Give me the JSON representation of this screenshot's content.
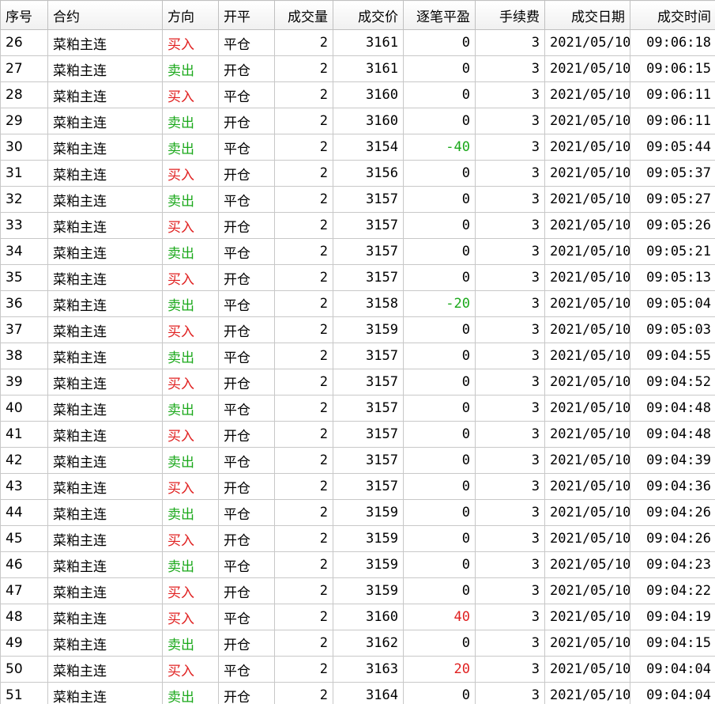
{
  "colors": {
    "buy": "#e02020",
    "sell": "#1aa81a",
    "grid_line": "#c8c8c8"
  },
  "columns": [
    "序号",
    "合约",
    "方向",
    "开平",
    "成交量",
    "成交价",
    "逐笔平盈",
    "手续费",
    "成交日期",
    "成交时间"
  ],
  "rows": [
    {
      "id": "26",
      "contract": "菜粕主连",
      "dir": "买入",
      "oc": "平仓",
      "qty": "2",
      "price": "3161",
      "pnl": "0",
      "fee": "3",
      "date": "2021/05/10",
      "time": "09:06:18"
    },
    {
      "id": "27",
      "contract": "菜粕主连",
      "dir": "卖出",
      "oc": "开仓",
      "qty": "2",
      "price": "3161",
      "pnl": "0",
      "fee": "3",
      "date": "2021/05/10",
      "time": "09:06:15"
    },
    {
      "id": "28",
      "contract": "菜粕主连",
      "dir": "买入",
      "oc": "平仓",
      "qty": "2",
      "price": "3160",
      "pnl": "0",
      "fee": "3",
      "date": "2021/05/10",
      "time": "09:06:11"
    },
    {
      "id": "29",
      "contract": "菜粕主连",
      "dir": "卖出",
      "oc": "开仓",
      "qty": "2",
      "price": "3160",
      "pnl": "0",
      "fee": "3",
      "date": "2021/05/10",
      "time": "09:06:11"
    },
    {
      "id": "30",
      "contract": "菜粕主连",
      "dir": "卖出",
      "oc": "平仓",
      "qty": "2",
      "price": "3154",
      "pnl": "-40",
      "fee": "3",
      "date": "2021/05/10",
      "time": "09:05:44"
    },
    {
      "id": "31",
      "contract": "菜粕主连",
      "dir": "买入",
      "oc": "开仓",
      "qty": "2",
      "price": "3156",
      "pnl": "0",
      "fee": "3",
      "date": "2021/05/10",
      "time": "09:05:37"
    },
    {
      "id": "32",
      "contract": "菜粕主连",
      "dir": "卖出",
      "oc": "平仓",
      "qty": "2",
      "price": "3157",
      "pnl": "0",
      "fee": "3",
      "date": "2021/05/10",
      "time": "09:05:27"
    },
    {
      "id": "33",
      "contract": "菜粕主连",
      "dir": "买入",
      "oc": "开仓",
      "qty": "2",
      "price": "3157",
      "pnl": "0",
      "fee": "3",
      "date": "2021/05/10",
      "time": "09:05:26"
    },
    {
      "id": "34",
      "contract": "菜粕主连",
      "dir": "卖出",
      "oc": "平仓",
      "qty": "2",
      "price": "3157",
      "pnl": "0",
      "fee": "3",
      "date": "2021/05/10",
      "time": "09:05:21"
    },
    {
      "id": "35",
      "contract": "菜粕主连",
      "dir": "买入",
      "oc": "开仓",
      "qty": "2",
      "price": "3157",
      "pnl": "0",
      "fee": "3",
      "date": "2021/05/10",
      "time": "09:05:13"
    },
    {
      "id": "36",
      "contract": "菜粕主连",
      "dir": "卖出",
      "oc": "平仓",
      "qty": "2",
      "price": "3158",
      "pnl": "-20",
      "fee": "3",
      "date": "2021/05/10",
      "time": "09:05:04"
    },
    {
      "id": "37",
      "contract": "菜粕主连",
      "dir": "买入",
      "oc": "开仓",
      "qty": "2",
      "price": "3159",
      "pnl": "0",
      "fee": "3",
      "date": "2021/05/10",
      "time": "09:05:03"
    },
    {
      "id": "38",
      "contract": "菜粕主连",
      "dir": "卖出",
      "oc": "平仓",
      "qty": "2",
      "price": "3157",
      "pnl": "0",
      "fee": "3",
      "date": "2021/05/10",
      "time": "09:04:55"
    },
    {
      "id": "39",
      "contract": "菜粕主连",
      "dir": "买入",
      "oc": "开仓",
      "qty": "2",
      "price": "3157",
      "pnl": "0",
      "fee": "3",
      "date": "2021/05/10",
      "time": "09:04:52"
    },
    {
      "id": "40",
      "contract": "菜粕主连",
      "dir": "卖出",
      "oc": "平仓",
      "qty": "2",
      "price": "3157",
      "pnl": "0",
      "fee": "3",
      "date": "2021/05/10",
      "time": "09:04:48"
    },
    {
      "id": "41",
      "contract": "菜粕主连",
      "dir": "买入",
      "oc": "开仓",
      "qty": "2",
      "price": "3157",
      "pnl": "0",
      "fee": "3",
      "date": "2021/05/10",
      "time": "09:04:48"
    },
    {
      "id": "42",
      "contract": "菜粕主连",
      "dir": "卖出",
      "oc": "平仓",
      "qty": "2",
      "price": "3157",
      "pnl": "0",
      "fee": "3",
      "date": "2021/05/10",
      "time": "09:04:39"
    },
    {
      "id": "43",
      "contract": "菜粕主连",
      "dir": "买入",
      "oc": "开仓",
      "qty": "2",
      "price": "3157",
      "pnl": "0",
      "fee": "3",
      "date": "2021/05/10",
      "time": "09:04:36"
    },
    {
      "id": "44",
      "contract": "菜粕主连",
      "dir": "卖出",
      "oc": "平仓",
      "qty": "2",
      "price": "3159",
      "pnl": "0",
      "fee": "3",
      "date": "2021/05/10",
      "time": "09:04:26"
    },
    {
      "id": "45",
      "contract": "菜粕主连",
      "dir": "买入",
      "oc": "开仓",
      "qty": "2",
      "price": "3159",
      "pnl": "0",
      "fee": "3",
      "date": "2021/05/10",
      "time": "09:04:26"
    },
    {
      "id": "46",
      "contract": "菜粕主连",
      "dir": "卖出",
      "oc": "平仓",
      "qty": "2",
      "price": "3159",
      "pnl": "0",
      "fee": "3",
      "date": "2021/05/10",
      "time": "09:04:23"
    },
    {
      "id": "47",
      "contract": "菜粕主连",
      "dir": "买入",
      "oc": "开仓",
      "qty": "2",
      "price": "3159",
      "pnl": "0",
      "fee": "3",
      "date": "2021/05/10",
      "time": "09:04:22"
    },
    {
      "id": "48",
      "contract": "菜粕主连",
      "dir": "买入",
      "oc": "平仓",
      "qty": "2",
      "price": "3160",
      "pnl": "40",
      "fee": "3",
      "date": "2021/05/10",
      "time": "09:04:19"
    },
    {
      "id": "49",
      "contract": "菜粕主连",
      "dir": "卖出",
      "oc": "开仓",
      "qty": "2",
      "price": "3162",
      "pnl": "0",
      "fee": "3",
      "date": "2021/05/10",
      "time": "09:04:15"
    },
    {
      "id": "50",
      "contract": "菜粕主连",
      "dir": "买入",
      "oc": "平仓",
      "qty": "2",
      "price": "3163",
      "pnl": "20",
      "fee": "3",
      "date": "2021/05/10",
      "time": "09:04:04"
    },
    {
      "id": "51",
      "contract": "菜粕主连",
      "dir": "卖出",
      "oc": "开仓",
      "qty": "2",
      "price": "3164",
      "pnl": "0",
      "fee": "3",
      "date": "2021/05/10",
      "time": "09:04:04"
    }
  ]
}
